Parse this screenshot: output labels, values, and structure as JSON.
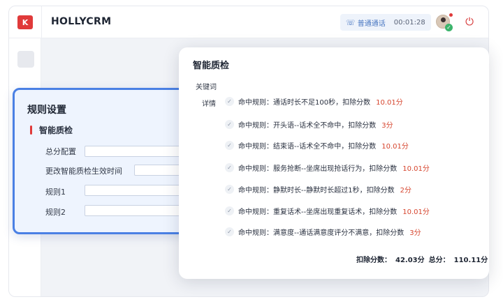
{
  "app": {
    "logo_text": "K",
    "title": "HOLLYCRM"
  },
  "call": {
    "type_label": "普通通话",
    "timer": "00:01:28"
  },
  "rules": {
    "title": "规则设置",
    "section": "智能质检",
    "fields": [
      {
        "label": "总分配置",
        "value": ""
      },
      {
        "label": "更改智能质检生效时间",
        "value": ""
      },
      {
        "label": "规则1",
        "value": ""
      },
      {
        "label": "规则2",
        "value": ""
      }
    ]
  },
  "qc": {
    "title": "智能质检",
    "keyword_label": "关键词",
    "detail_label": "详情",
    "hits": [
      {
        "text": "命中规则：通话时长不足100秒，扣除分数",
        "score": "10.01分"
      },
      {
        "text": "命中规则：开头语--话术全不命中，扣除分数",
        "score": "3分"
      },
      {
        "text": "命中规则：结束语--话术全不命中，扣除分数",
        "score": "10.01分"
      },
      {
        "text": "命中规则：服务抢断--坐席出现抢话行为，扣除分数",
        "score": "10.01分"
      },
      {
        "text": "命中规则：静默时长--静默时长超过1秒，扣除分数",
        "score": "2分"
      },
      {
        "text": "命中规则：重复话术--坐席出现重复话术，扣除分数",
        "score": "10.01分"
      },
      {
        "text": "命中规则：满意度--通话满意度评分不满意，扣除分数",
        "score": "3分"
      }
    ],
    "deducted_label": "扣除分数：",
    "deducted_value": "42.03分",
    "total_label": "总分：",
    "total_value": "110.11分"
  },
  "colors": {
    "accent": "#4a80e4",
    "brand": "#e03a3a",
    "score": "#d6452e",
    "success": "#3bb46b"
  },
  "icons": {
    "phone": "phone-icon",
    "power": "power-icon",
    "check": "check-icon"
  }
}
